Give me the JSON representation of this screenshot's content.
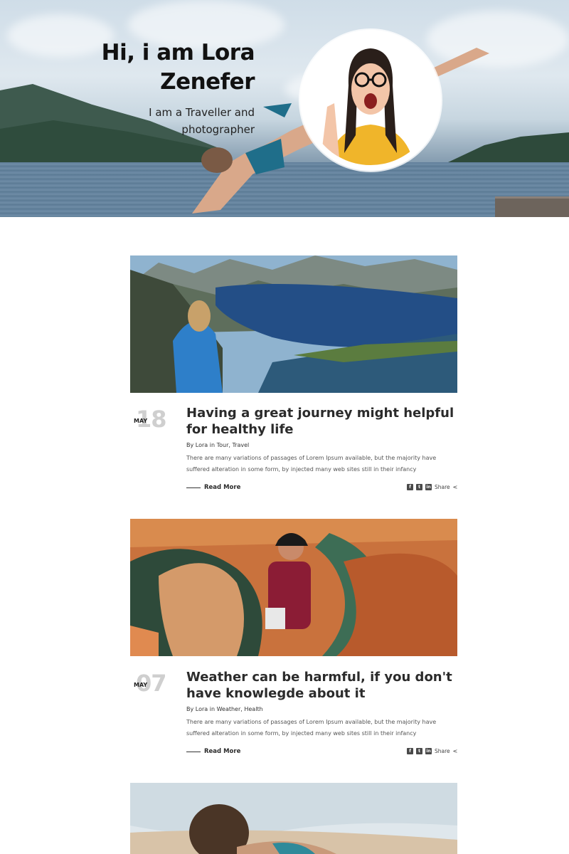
{
  "hero": {
    "title": "Hi, i am Lora Zenefer",
    "subtitle": "I am a Traveller and photographer"
  },
  "posts": [
    {
      "day": "18",
      "month": "MAY",
      "title": "Having a great journey might helpful for healthy life",
      "by_label": "By",
      "author": "Lora",
      "in_label": "in",
      "categories": "Tour, Travel",
      "excerpt": "There are many variations of passages of Lorem Ipsum available, but the majority have suffered alteration in some form, by injected many web sites still in their infancy",
      "read_more": "Read More",
      "share_label": "Share"
    },
    {
      "day": "07",
      "month": "MAY",
      "title": "Weather can be harmful, if you don't have knowlegde about it",
      "by_label": "By",
      "author": "Lora",
      "in_label": "in",
      "categories": "Weather, Health",
      "excerpt": "There are many variations of passages of Lorem Ipsum available, but the majority have suffered alteration in some form, by injected many web sites still in their infancy",
      "read_more": "Read More",
      "share_label": "Share"
    }
  ],
  "icons": {
    "facebook": "facebook-icon",
    "twitter": "twitter-icon",
    "linkedin": "linkedin-icon",
    "share": "share-icon"
  },
  "colors": {
    "text": "#2b2b2b",
    "date_day": "#cfcfcf",
    "muted": "#555555"
  }
}
